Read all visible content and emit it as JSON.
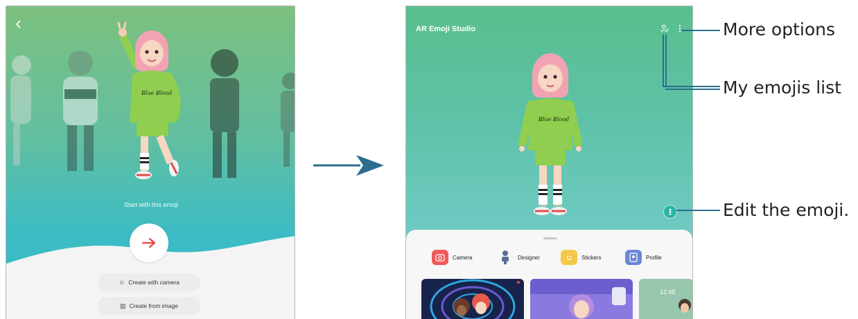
{
  "left_screen": {
    "start_text": "Start with this emoji",
    "buttons": {
      "create_with_camera": "Create with camera",
      "create_from_image": "Create from image"
    },
    "icons": {
      "back": "back-chevron-icon",
      "next": "arrow-right-icon",
      "camera": "face-outline-icon",
      "image": "image-icon"
    }
  },
  "right_screen": {
    "app_title": "AR Emoji Studio",
    "menu": [
      {
        "label": "Camera",
        "icon": "camera-icon",
        "color": "#ef5a5a"
      },
      {
        "label": "Designer",
        "icon": "designer-icon",
        "color": "#5b6f95"
      },
      {
        "label": "Stickers",
        "icon": "sticker-icon",
        "color": "#f5c84a"
      },
      {
        "label": "Profile",
        "icon": "profile-icon",
        "color": "#6d86d8"
      }
    ]
  },
  "callouts": {
    "more_options": "More options",
    "my_emojis_list": "My emojis list",
    "edit_emoji": "Edit the emoji."
  },
  "colors": {
    "accent_blue": "#2c6d91",
    "next_arrow": "#e8483f",
    "edit_button": "#2bb4a6"
  }
}
